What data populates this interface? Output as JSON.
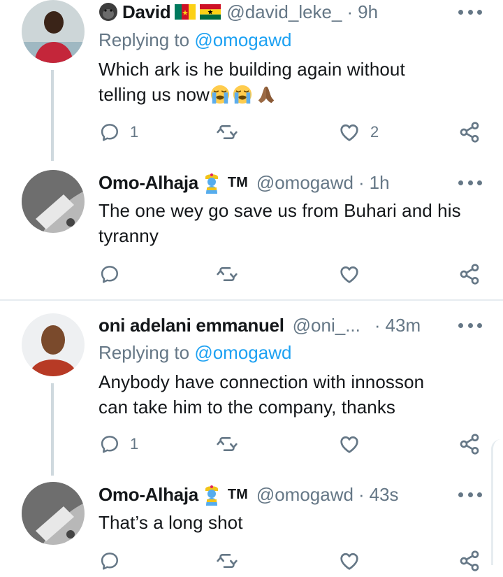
{
  "tweets": [
    {
      "name": "David",
      "handle": "@david_leke_",
      "dot": "·",
      "time": "9h",
      "replying_prefix": "Replying to",
      "replying_to": "@omogawd",
      "text_line1": "Which ark is he building again without",
      "text_line2": "telling us now",
      "emojis": [
        "loudly-crying-face",
        "loudly-crying-face",
        "folded-hands"
      ],
      "reply_count": "1",
      "retweet_count": "",
      "like_count": "2"
    },
    {
      "name": "Omo-Alhaja",
      "badge": "TM",
      "handle": "@omogawd",
      "dot": "·",
      "time": "1h",
      "text_line1": "The one wey go save us from Buhari and his",
      "text_line2": "tyranny",
      "reply_count": "",
      "retweet_count": "",
      "like_count": ""
    },
    {
      "name": "oni adelani emmanuel",
      "handle": "@oni_...",
      "dot": "·",
      "time": "43m",
      "replying_prefix": "Replying to",
      "replying_to": "@omogawd",
      "text_line1": "Anybody have connection with innosson",
      "text_line2": "can take him to the company, thanks",
      "reply_count": "1",
      "retweet_count": "",
      "like_count": ""
    },
    {
      "name": "Omo-Alhaja",
      "badge": "TM",
      "handle": "@omogawd",
      "dot": "·",
      "time": "43s",
      "text_line1": "That’s a long shot",
      "reply_count": "",
      "retweet_count": "",
      "like_count": ""
    }
  ],
  "colors": {
    "secondary_text": "#657786",
    "link": "#1da1f2",
    "thread_line": "#cfd9de",
    "separator": "#e6ecf0"
  },
  "icons": [
    "gorilla-icon",
    "cameroon-flag-icon",
    "ghana-flag-icon",
    "genie-icon",
    "reply-icon",
    "retweet-icon",
    "like-icon",
    "share-icon",
    "more-icon"
  ]
}
